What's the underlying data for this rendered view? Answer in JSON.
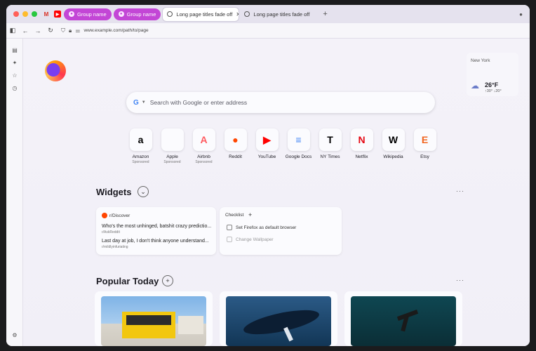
{
  "tabstrip": {
    "groups": [
      {
        "label": "Group name"
      },
      {
        "label": "Group name"
      }
    ],
    "tabs": [
      {
        "title": "Long page titles fade off",
        "active": true
      },
      {
        "title": "Long page titles fade off",
        "active": false
      }
    ],
    "new_tab": "+"
  },
  "navbar": {
    "url": "www.example.com/path/to/page"
  },
  "weather": {
    "city": "New York",
    "temp": "26°F",
    "high": "↑30°",
    "low": "↓20°"
  },
  "search": {
    "placeholder": "Search with Google or enter address",
    "engine_letter": "G"
  },
  "shortcuts": [
    {
      "label": "Amazon",
      "sub": "Sponsored",
      "glyph": "a",
      "color": "#000000"
    },
    {
      "label": "Apple",
      "sub": "Sponsored",
      "glyph": "",
      "color": "#000000"
    },
    {
      "label": "Airbnb",
      "sub": "Sponsored",
      "glyph": "A",
      "color": "#ff5a5f"
    },
    {
      "label": "Reddit",
      "sub": "",
      "glyph": "●",
      "color": "#ff4500"
    },
    {
      "label": "YouTube",
      "sub": "",
      "glyph": "▶",
      "color": "#ff0000"
    },
    {
      "label": "Google Docs",
      "sub": "",
      "glyph": "≡",
      "color": "#4285f4"
    },
    {
      "label": "NY Times",
      "sub": "",
      "glyph": "T",
      "color": "#000000"
    },
    {
      "label": "Netflix",
      "sub": "",
      "glyph": "N",
      "color": "#e50914"
    },
    {
      "label": "Wikipedia",
      "sub": "",
      "glyph": "W",
      "color": "#000000"
    },
    {
      "label": "Etsy",
      "sub": "",
      "glyph": "E",
      "color": "#f1641e"
    }
  ],
  "widgets": {
    "title": "Widgets",
    "discover": {
      "source": "r/Discover",
      "items": [
        {
          "title": "Who's the most unhinged, batshit crazy predictio...",
          "sub": "r/AskReddit"
        },
        {
          "title": "Last day at job, I don't think anyone understand...",
          "sub": "r/mildlyinfuriating"
        }
      ]
    },
    "checklist": {
      "title": "Checklist",
      "items": [
        "Set Firefox as default browser",
        "Change Wallpaper"
      ]
    }
  },
  "popular": {
    "title": "Popular Today"
  }
}
